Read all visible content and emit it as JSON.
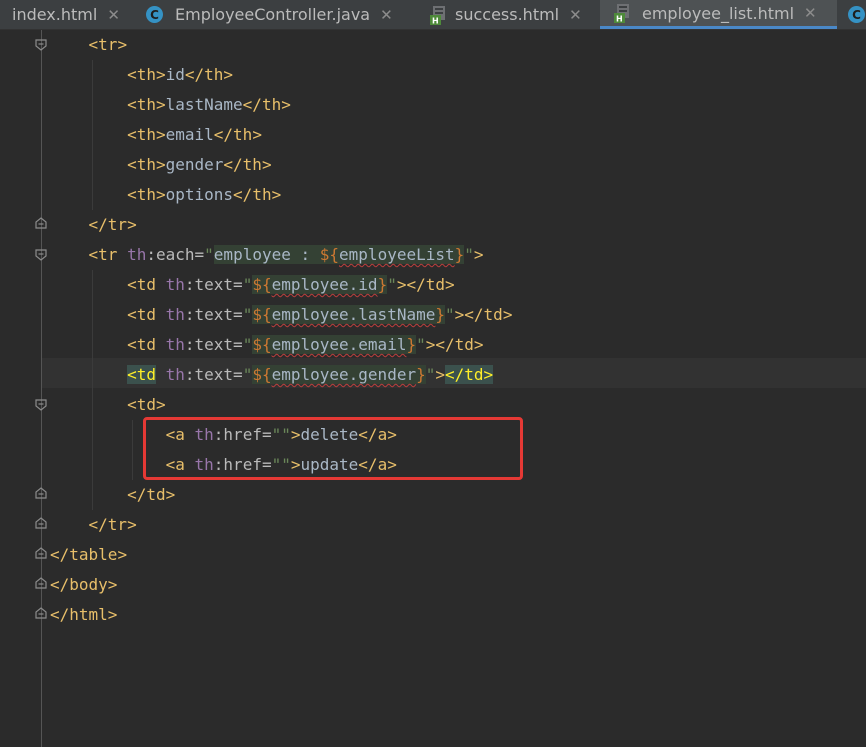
{
  "tabs": [
    {
      "label": "index.html",
      "icon": "html-file-icon",
      "active": false
    },
    {
      "label": "EmployeeController.java",
      "icon": "java-class-icon",
      "active": false
    },
    {
      "label": "success.html",
      "icon": "html-file-icon",
      "active": false
    },
    {
      "label": "employee_list.html",
      "icon": "html-file-icon",
      "active": true
    },
    {
      "label": "",
      "icon": "java-class-icon",
      "active": false
    }
  ],
  "tab_close_glyph": "✕",
  "code": {
    "tr": "tr",
    "th": "th",
    "td": "td",
    "a": "a",
    "table": "table",
    "body": "body",
    "html": "html",
    "headers": [
      "id",
      "lastName",
      "email",
      "gender",
      "options"
    ],
    "ns": "th",
    "each_attr": "each",
    "text_attr": "text",
    "href_attr": "href",
    "each_var": "employee : ",
    "employee_list": "employeeList",
    "fields": [
      "employee.id",
      "employee.lastName",
      "employee.email",
      "employee.gender"
    ],
    "links": [
      "delete",
      "update"
    ]
  },
  "colors": {
    "background": "#2b2b2b",
    "tag": "#e8bf6a",
    "namespace": "#9876aa",
    "string": "#6a8759",
    "highlight_box": "#e53935"
  }
}
